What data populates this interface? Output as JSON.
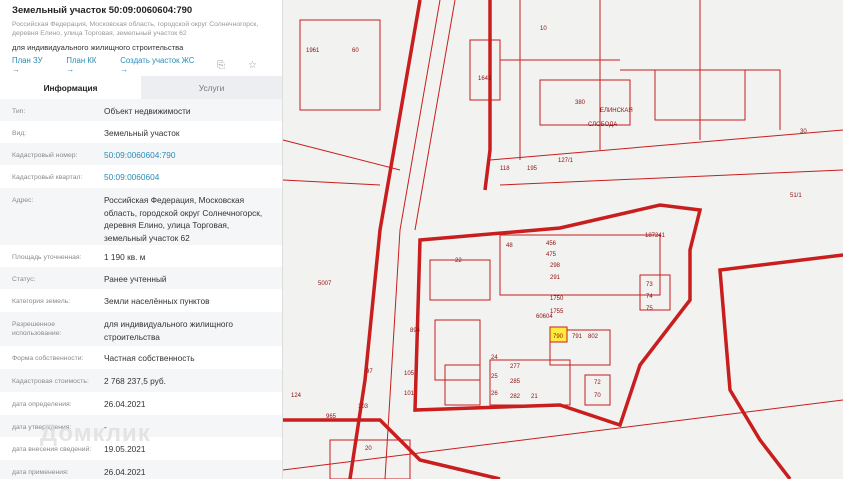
{
  "header": {
    "title": "Земельный участок 50:09:0060604:790",
    "address": "Российская Федерация, Московская область, городской округ Солнечногорск, деревня Елино, улица Торговая, земельный участок 62",
    "usage": "для индивидуального жилищного строительства",
    "links": [
      "План ЗУ →",
      "План КК →",
      "Создать участок ЖС →"
    ],
    "icons": [
      "search-document-icon",
      "star-icon"
    ]
  },
  "tabs": [
    {
      "label": "Информация",
      "active": true
    },
    {
      "label": "Услуги",
      "active": false
    }
  ],
  "rows": [
    {
      "k": "Тип:",
      "v": "Объект недвижимости"
    },
    {
      "k": "Вид:",
      "v": "Земельный участок"
    },
    {
      "k": "Кадастровый номер:",
      "v": "50:09:0060604:790"
    },
    {
      "k": "Кадастровый квартал:",
      "v": "50:09:0060604"
    },
    {
      "k": "Адрес:",
      "v": "Российская Федерация, Московская область, городской округ Солнечногорск, деревня Елино, улица Торговая, земельный участок 62"
    },
    {
      "k": "Площадь уточненная:",
      "v": "1 190 кв. м"
    },
    {
      "k": "Статус:",
      "v": "Ранее учтенный"
    },
    {
      "k": "Категория земель:",
      "v": "Земли населённых пунктов"
    },
    {
      "k": "Разрешенное использование:",
      "v": "для индивидуального жилищного строительства"
    },
    {
      "k": "Форма собственности:",
      "v": "Частная собственность"
    },
    {
      "k": "Кадастровая стоимость:",
      "v": "2 768 237,5 руб."
    },
    {
      "k": "дата определения:",
      "v": "26.04.2021"
    },
    {
      "k": "дата утверждения:",
      "v": "-"
    },
    {
      "k": "дата внесения сведений:",
      "v": "19.05.2021"
    },
    {
      "k": "дата применения:",
      "v": "26.04.2021"
    }
  ],
  "watermark": "Домклик",
  "map": {
    "labels": [
      "1961",
      "60",
      "1643",
      "10",
      "380",
      "ЕЛИНСКАЯ",
      "СЛОБОДА",
      "30",
      "51/1",
      "118",
      "195",
      "127/1",
      "187241",
      "22",
      "48",
      "456",
      "475",
      "298",
      "291",
      "1750",
      "1755",
      "60604",
      "894",
      "24",
      "25",
      "26",
      "277",
      "285",
      "282",
      "21",
      "72",
      "70",
      "105",
      "101",
      "103",
      "124",
      "965",
      "20",
      "5007",
      "97",
      "73",
      "74",
      "75",
      "790",
      "791",
      "802"
    ],
    "accent": "#c81e1e",
    "highlight": "#ffec3d"
  }
}
